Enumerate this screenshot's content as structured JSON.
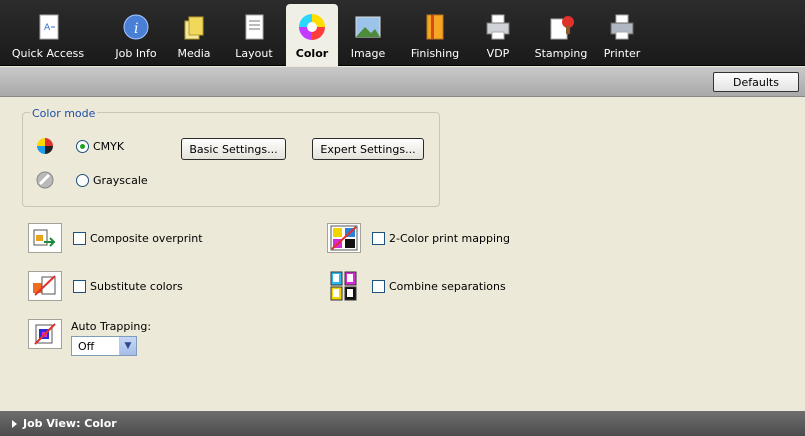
{
  "toolbar": {
    "tabs": [
      {
        "label": "Quick Access",
        "icon": "quick-access-icon"
      },
      {
        "label": "Job Info",
        "icon": "info-icon"
      },
      {
        "label": "Media",
        "icon": "media-icon"
      },
      {
        "label": "Layout",
        "icon": "layout-icon"
      },
      {
        "label": "Color",
        "icon": "color-wheel-icon",
        "active": true
      },
      {
        "label": "Image",
        "icon": "image-icon"
      },
      {
        "label": "Finishing",
        "icon": "finishing-icon"
      },
      {
        "label": "VDP",
        "icon": "vdp-icon"
      },
      {
        "label": "Stamping",
        "icon": "stamping-icon"
      },
      {
        "label": "Printer",
        "icon": "printer-icon"
      }
    ]
  },
  "defaults_label": "Defaults",
  "color_mode": {
    "legend": "Color mode",
    "cmyk_label": "CMYK",
    "grayscale_label": "Grayscale",
    "selected": "CMYK",
    "basic_settings": "Basic Settings...",
    "expert_settings": "Expert Settings..."
  },
  "options": {
    "composite_overprint": "Composite overprint",
    "two_color_mapping": "2-Color print mapping",
    "substitute_colors": "Substitute colors",
    "combine_separations": "Combine separations",
    "auto_trapping_label": "Auto Trapping:",
    "auto_trapping_value": "Off"
  },
  "job_view_label": "Job View: Color",
  "colors": {
    "toolbar_bg": "#1a1a1a",
    "panel_bg": "#ece9d8",
    "legend_text": "#1f4fa8",
    "radio_dot": "#21a121"
  }
}
